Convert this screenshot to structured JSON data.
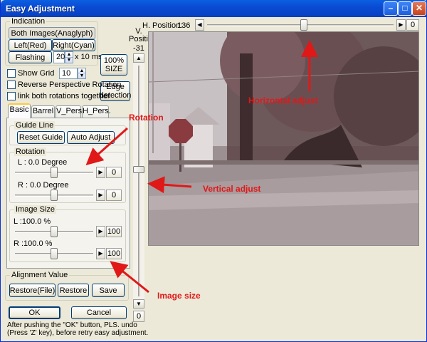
{
  "window": {
    "title": "Easy Adjustment"
  },
  "indication": {
    "label": "Indication",
    "both_images": "Both Images(Anaglyph)",
    "left": "Left(Red)",
    "right": "Right(Cyan)",
    "flashing": "Flashing",
    "flash_value": "20",
    "flash_unit": "x 10 ms."
  },
  "size_button": "100%\nSIZE",
  "edge_button": "Edge\ndetection",
  "options": {
    "show_grid": "Show Grid",
    "grid_value": "10",
    "reverse_perspective": "Reverse Perspective Rotation",
    "link_rotations": "link both rotations together"
  },
  "tabs": [
    "Basic",
    "Barrel",
    "V_Pers.",
    "H_Pers."
  ],
  "guide_line": {
    "label": "Guide Line",
    "reset": "Reset Guide",
    "auto": "Auto Adjust"
  },
  "rotation": {
    "label": "Rotation",
    "l_label": "L : 0.0 Degree",
    "l_value": "0",
    "l_level": 0.5,
    "r_label": "R : 0.0 Degree",
    "r_value": "0",
    "r_level": 0.5
  },
  "image_size": {
    "label": "Image Size",
    "l_label": "L :100.0 %",
    "l_value": "100",
    "l_level": 0.5,
    "r_label": "R :100.0 %",
    "r_value": "100",
    "r_level": 0.5
  },
  "alignment": {
    "label": "Alignment Value",
    "restore_file": "Restore(File)",
    "restore": "Restore",
    "save": "Save"
  },
  "ok": "OK",
  "cancel": "Cancel",
  "note": "After pushing the \"OK\" button, PLS. undo\n(Press 'Z' key), before retry easy adjustment.",
  "h_position": {
    "label": "H. Position:",
    "value": "136",
    "box": "0",
    "level": 0.52
  },
  "v_position": {
    "label": "V.\nPosition",
    "value": "-31",
    "box": "0",
    "level": 0.45
  },
  "annotations": {
    "horizontal": "Horizontal adjust",
    "vertical": "Vertical adjust",
    "rotation": "Rotation",
    "image_size": "Image size"
  },
  "colors": {
    "accent": "#e01818",
    "titlebar": "#0b4bd4"
  }
}
